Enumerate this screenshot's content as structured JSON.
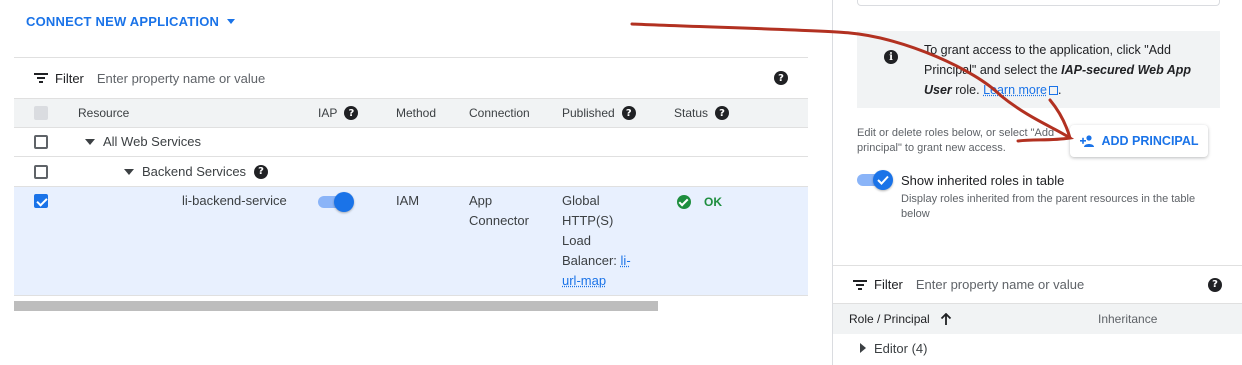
{
  "left": {
    "connect_button": "CONNECT NEW APPLICATION",
    "filter": {
      "label": "Filter",
      "placeholder": "Enter property name or value"
    },
    "columns": {
      "resource": "Resource",
      "iap": "IAP",
      "method": "Method",
      "connection": "Connection",
      "published": "Published",
      "status": "Status"
    },
    "rows": {
      "all_web_services": "All Web Services",
      "backend_services": "Backend Services",
      "service": {
        "name": "li-backend-service",
        "iap_enabled": true,
        "method": "IAM",
        "connection_line1": "App",
        "connection_line2": "Connector",
        "published_line1": "Global",
        "published_line2": "HTTP(S)",
        "published_line3": "Load",
        "published_line4": "Balancer:",
        "published_link1": "li-",
        "published_link2": "url-map",
        "status": "OK"
      }
    }
  },
  "right": {
    "info": {
      "part1": "To grant access to the application, click \"Add Principal\" and select the ",
      "role_name": "IAP-secured Web App User",
      "part2": " role. ",
      "learn_more": "Learn more"
    },
    "edit_text": "Edit or delete roles below, or select \"Add principal\" to grant new access.",
    "add_principal": "ADD PRINCIPAL",
    "inherited": {
      "enabled": true,
      "label": "Show inherited roles in table",
      "description": "Display roles inherited from the parent resources in the table below"
    },
    "filter": {
      "label": "Filter",
      "placeholder": "Enter property name or value"
    },
    "table": {
      "role_header": "Role / Principal",
      "inheritance_header": "Inheritance",
      "rows": [
        {
          "label": "Editor (4)"
        }
      ]
    }
  },
  "colors": {
    "accent": "#1a73e8",
    "ok": "#1e8e3e",
    "annotation": "#b23121",
    "selected_row": "#e8f0fe"
  }
}
